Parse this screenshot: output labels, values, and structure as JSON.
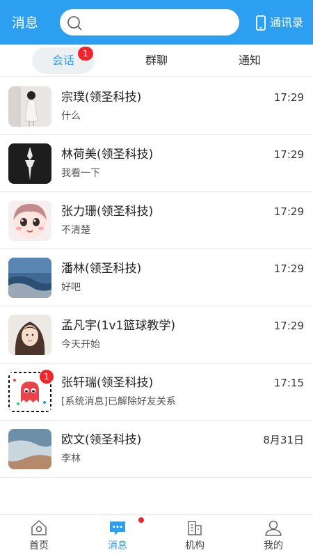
{
  "header": {
    "title": "消息",
    "search_placeholder": "",
    "contacts_label": "通讯录",
    "icons": {
      "search": "search-icon",
      "contacts": "phone-icon"
    }
  },
  "tabs": {
    "items": [
      {
        "label": "会话",
        "active": true
      },
      {
        "label": "群聊",
        "active": false
      },
      {
        "label": "通知",
        "active": false
      }
    ],
    "badge": "1"
  },
  "conversations": [
    {
      "name": "宗璞(领圣科技)",
      "preview": "什么",
      "time": "17:29",
      "badge": ""
    },
    {
      "name": "林荷美(领圣科技)",
      "preview": "我看一下",
      "time": "17:29",
      "badge": ""
    },
    {
      "name": "张力珊(领圣科技)",
      "preview": "不清楚",
      "time": "17:29",
      "badge": ""
    },
    {
      "name": "潘林(领圣科技)",
      "preview": "好吧",
      "time": "17:29",
      "badge": ""
    },
    {
      "name": "孟凡宇(1v1篮球教学)",
      "preview": "今天开始",
      "time": "17:29",
      "badge": ""
    },
    {
      "name": "张轩瑞(领圣科技)",
      "preview": "[系统消息]已解除好友关系",
      "time": "17:15",
      "badge": "1"
    },
    {
      "name": "欧文(领圣科技)",
      "preview": "李林",
      "time": "8月31日",
      "badge": ""
    }
  ],
  "bottom_nav": {
    "items": [
      {
        "label": "首页",
        "icon": "home-icon",
        "active": false
      },
      {
        "label": "消息",
        "icon": "message-icon",
        "active": true
      },
      {
        "label": "机构",
        "icon": "building-icon",
        "active": false
      },
      {
        "label": "我的",
        "icon": "profile-icon",
        "active": false
      }
    ]
  },
  "colors": {
    "primary": "#2d9ff0",
    "badge": "#f0262c",
    "tab_active_bg": "#edf0f3"
  }
}
